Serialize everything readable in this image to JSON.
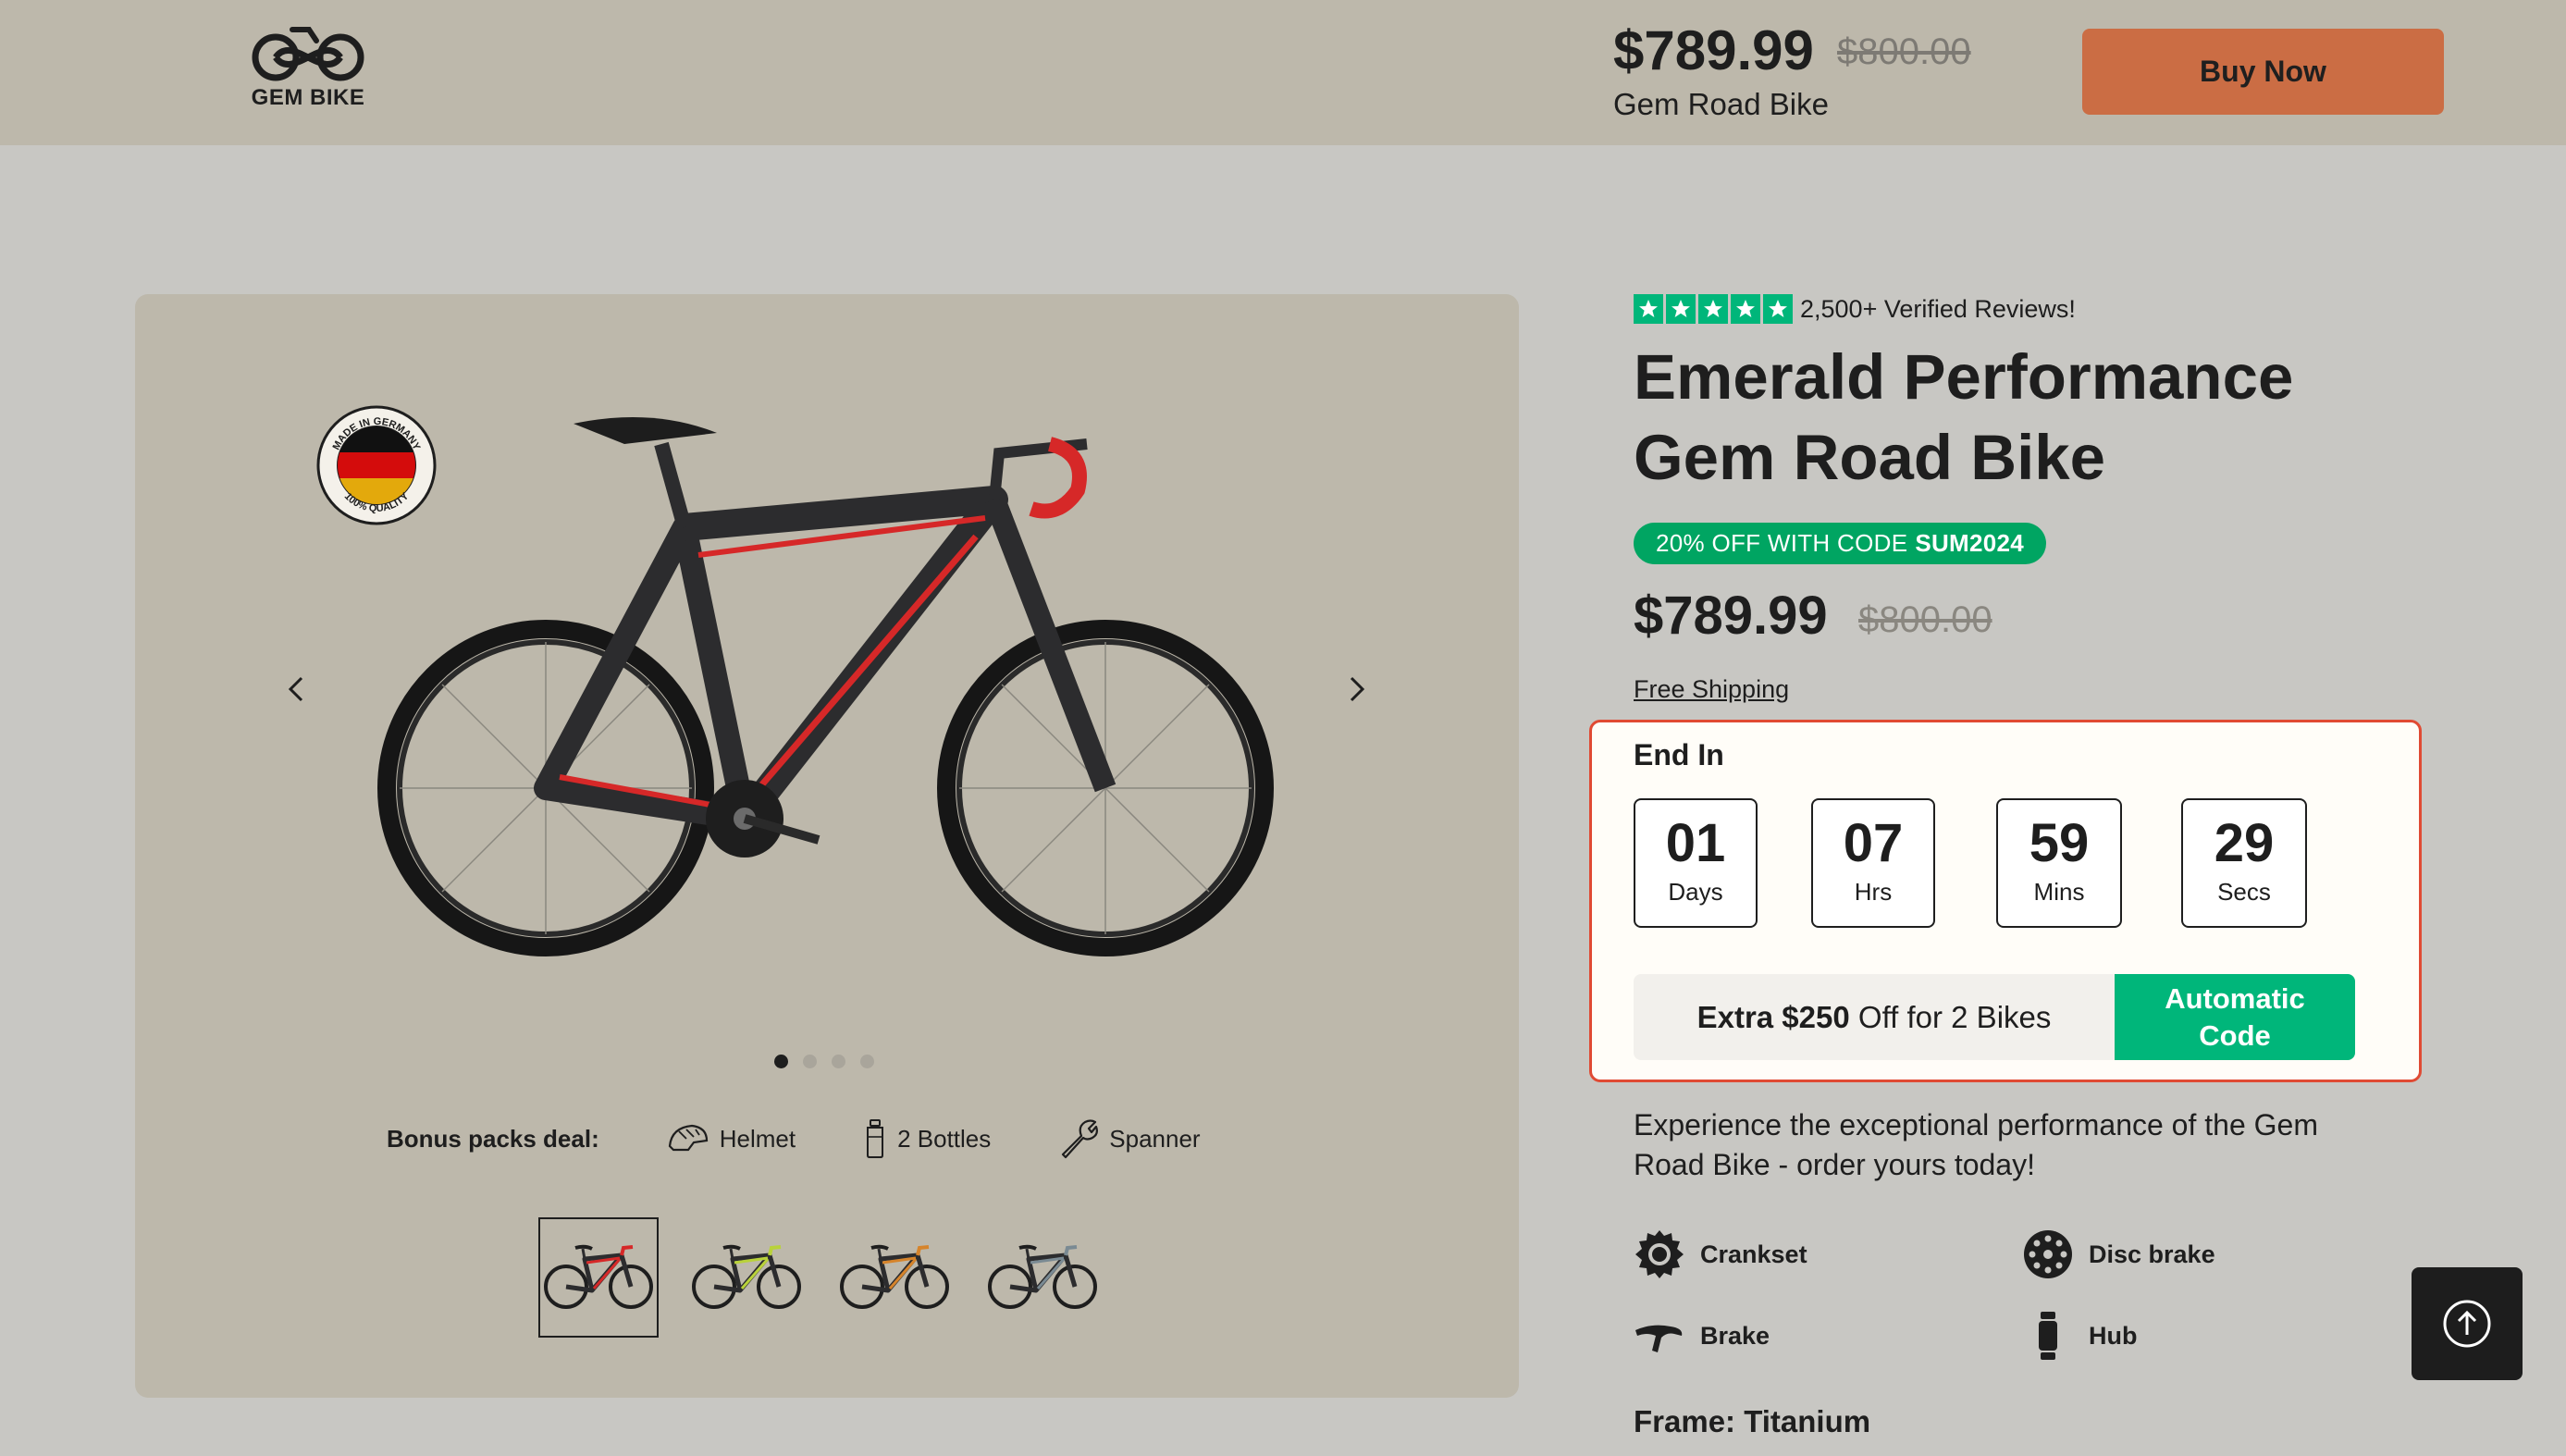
{
  "header": {
    "logo_text": "GEM BIKE",
    "price": "$789.99",
    "old_price": "$800.00",
    "product_name": "Gem Road Bike",
    "buy_label": "Buy Now"
  },
  "gallery": {
    "badge_top_text": "MADE IN GERMANY",
    "badge_bottom_text": "100% QUALITY",
    "slides_total": 4,
    "active_slide": 1,
    "bonus_label": "Bonus packs deal:",
    "bonus_items": [
      "Helmet",
      "2 Bottles",
      "Spanner"
    ],
    "thumbnail_accents": [
      "#d62828",
      "#b9d23a",
      "#d6842b",
      "#7a8a93"
    ]
  },
  "product": {
    "rating_stars": 5,
    "reviews": "2,500+ Verified Reviews!",
    "title_line1": "Emerald Performance",
    "title_line2": "Gem Road Bike",
    "promo_text": "20% OFF WITH CODE",
    "promo_code": "SUM2024",
    "price": "$789.99",
    "old_price": "$800.00",
    "shipping": "Free Shipping",
    "timer": {
      "label": "End In",
      "days": "01",
      "days_label": "Days",
      "hours": "07",
      "hours_label": "Hrs",
      "mins": "59",
      "mins_label": "Mins",
      "secs": "29",
      "secs_label": "Secs"
    },
    "deal_bold": "Extra $250",
    "deal_rest": "Off for 2 Bikes",
    "auto_code_line1": "Automatic",
    "auto_code_line2": "Code",
    "description": "Experience the exceptional performance of the Gem Road Bike - order yours today!",
    "features": [
      "Crankset",
      "Disc brake",
      "Brake",
      "Hub"
    ],
    "frame_label": "Frame: Titanium"
  },
  "colors": {
    "header_bg": "#bdb8ab",
    "page_bg": "#c8c7c3",
    "buy_button": "#cb6d44",
    "accent_green": "#00b67a",
    "promo_green": "#00a562",
    "timer_border": "#e04a33",
    "bike_accent": "#d62828"
  },
  "icons": {
    "logo": "bike-infinity-logo-icon",
    "badge": "germany-flag-badge-icon",
    "prev": "chevron-left-icon",
    "next": "chevron-right-icon",
    "helmet": "helmet-icon",
    "bottle": "bottle-icon",
    "spanner": "spanner-icon",
    "crankset": "crankset-icon",
    "disc_brake": "disc-brake-icon",
    "brake": "brake-lever-icon",
    "hub": "hub-icon",
    "scroll_top": "arrow-up-circle-icon"
  }
}
